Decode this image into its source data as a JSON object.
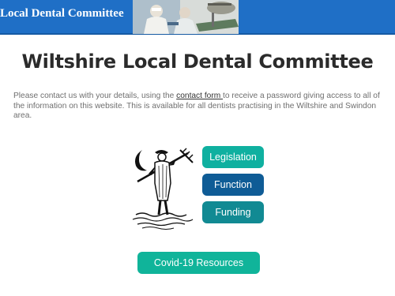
{
  "header": {
    "site_title": "Local Dental Committee",
    "photo_icon": "dentists-at-work-photo"
  },
  "main": {
    "title": "Wiltshire Local Dental Committee",
    "intro_before_link": "Please contact us with your details, using the ",
    "intro_link": "contact form ",
    "intro_after_link": "to receive a password giving access to all of the information on this website. This is available for all dentists practising in the Wiltshire and Swindon area.",
    "emblem_icon": "moonraker-emblem-icon"
  },
  "buttons": {
    "legislation": "Legislation",
    "function": "Function",
    "funding": "Funding",
    "covid": "Covid-19 Resources"
  },
  "colors": {
    "banner": "#1f6fc6",
    "legislation": "#0fb0a0",
    "function": "#0f5c96",
    "funding": "#118a93",
    "covid": "#10b49a"
  }
}
